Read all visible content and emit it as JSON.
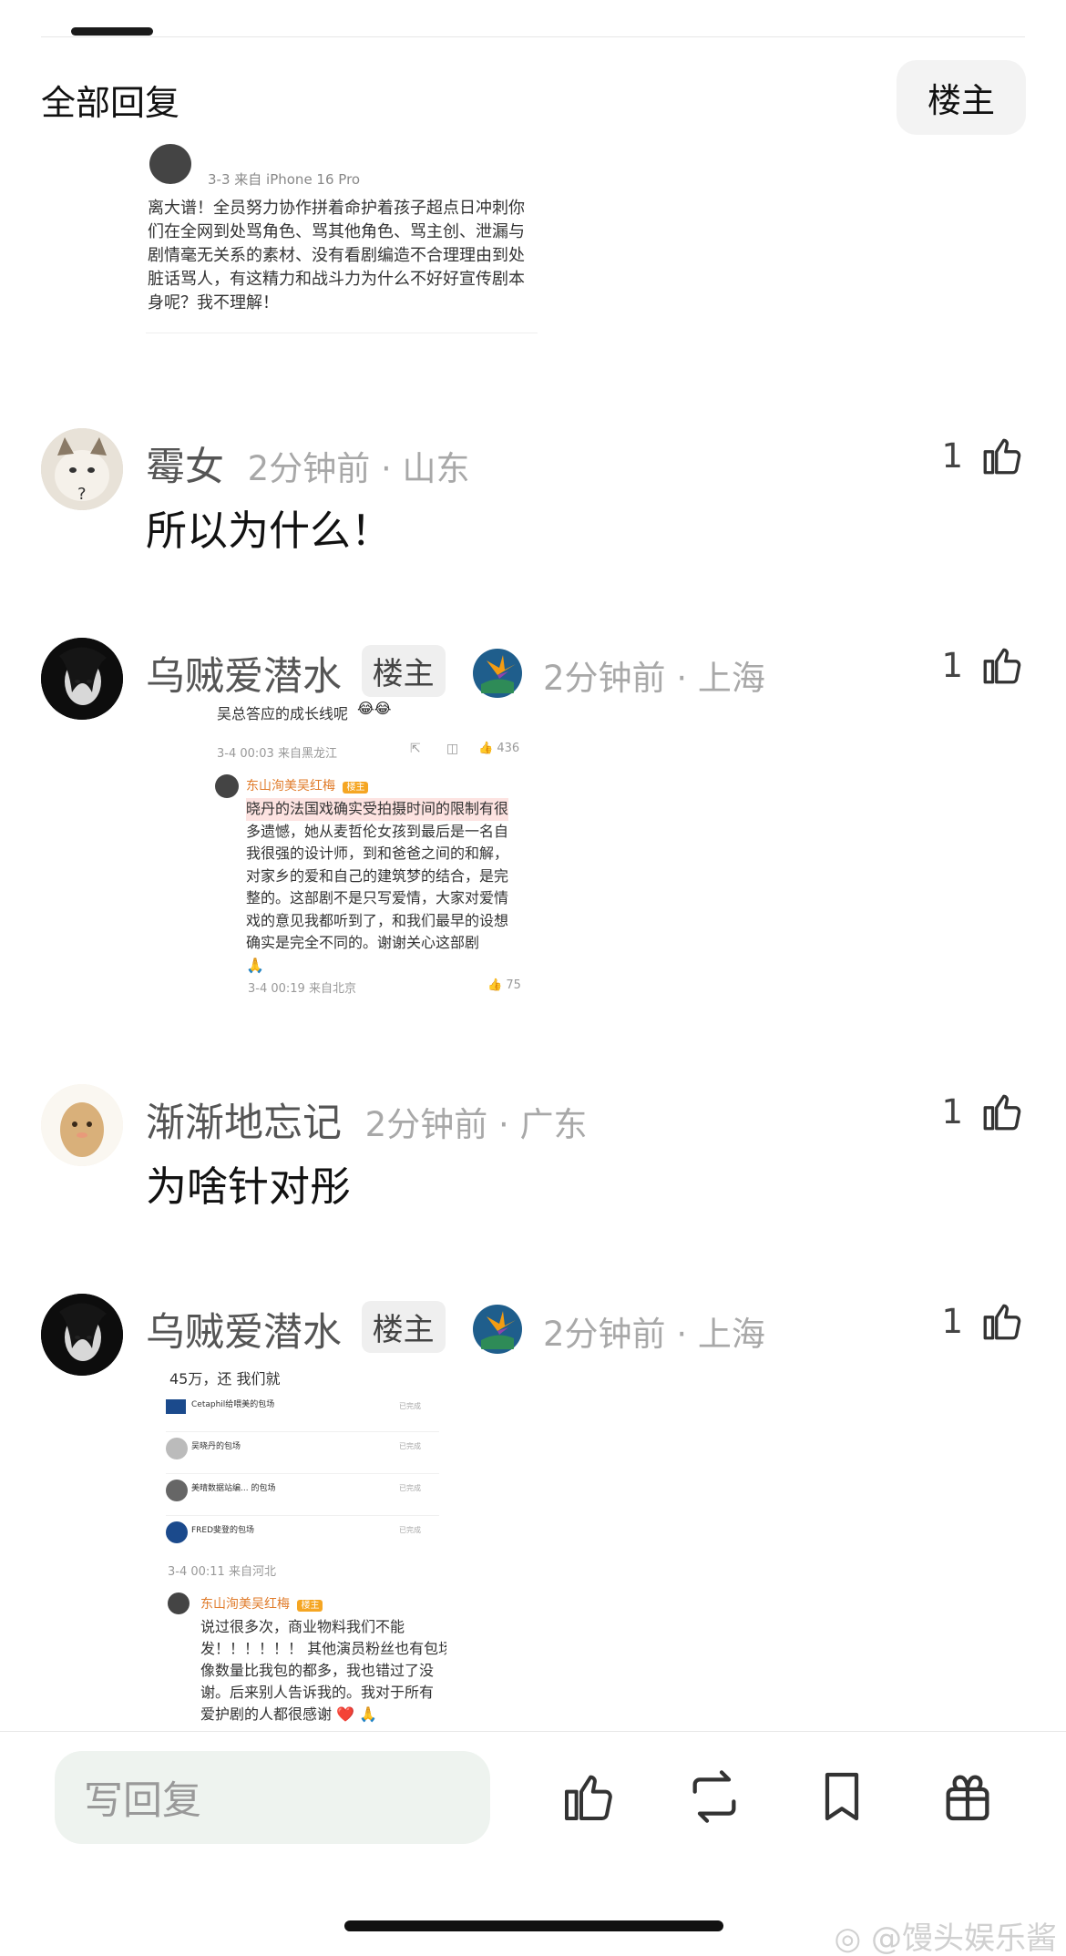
{
  "header": {
    "title": "全部回复",
    "owner_filter": "楼主"
  },
  "embed_top": {
    "date_line": "3-3  来自 iPhone 16 Pro",
    "lines": [
      "离大谱！全员努力协作拼着命护着孩子超点日冲刺你",
      "们在全网到处骂角色、骂其他角色、骂主创、泄漏与",
      "剧情毫无关系的素材、没有看剧编造不合理理由到处",
      "脏话骂人，有这精力和战斗力为什么不好好宣传剧本",
      "身呢？我不理解！"
    ]
  },
  "comments": [
    {
      "name": "霉女",
      "meta": "2分钟前 · 山东",
      "body": "所以为什么！",
      "likes": "1"
    },
    {
      "name": "乌贼爱潜水",
      "badge": "楼主",
      "meta": "2分钟前 · 上海",
      "likes": "1"
    },
    {
      "name": "渐渐地忘记",
      "meta": "2分钟前 · 广东",
      "body": "为啥针对彤",
      "likes": "1"
    },
    {
      "name": "乌贼爱潜水",
      "badge": "楼主",
      "meta": "2分钟前 · 上海",
      "likes": "1"
    }
  ],
  "embed_a": {
    "top_line": "吴总答应的成长线呢",
    "meta1": "3-4 00:03  来自黑龙江",
    "like1": "436",
    "author": "东山洵美吴红梅",
    "author_badge": "楼主",
    "lines": [
      "晓丹的法国戏确实受拍摄时间的限制有很",
      "多遗憾，她从麦哲伦女孩到最后是一名自",
      "我很强的设计师，到和爸爸之间的和解，",
      "对家乡的爱和自己的建筑梦的结合，是完",
      "整的。这部剧不是只写爱情，大家对爱情",
      "戏的意见我都听到了，和我们最早的设想",
      "确实是完全不同的。谢谢关心这部剧"
    ],
    "meta2": "3-4 00:19  来自北京",
    "like2": "75"
  },
  "embed_b": {
    "top_line": "45万，还    我们就",
    "items": [
      {
        "name": "Cetaphil给喂美的包场",
        "status": "已完成"
      },
      {
        "name": "吴晓丹的包场",
        "status": "已完成"
      },
      {
        "name": "美晴数据站编...  的包场",
        "status": "已完成"
      },
      {
        "name": "FRED斐登的包场",
        "status": "已完成"
      }
    ],
    "meta": "3-4 00:11  来自河北",
    "author": "东山洵美吴红梅",
    "author_badge": "楼主",
    "lines": [
      "说过很多次，商业物料我们不能",
      "发！！！！！！ 其他演员粉丝也有包场，",
      "像数量比我包的都多，我也错过了没",
      "谢。后来别人告诉我的。我对于所有",
      "爱护剧的人都很感谢"
    ]
  },
  "footer": {
    "reply_placeholder": "写回复"
  },
  "watermark": "@馒头娱乐酱",
  "colors": {
    "highlight": "#fde3e1",
    "badge_orange": "#f5a623",
    "link_orange": "#e07b2a"
  }
}
